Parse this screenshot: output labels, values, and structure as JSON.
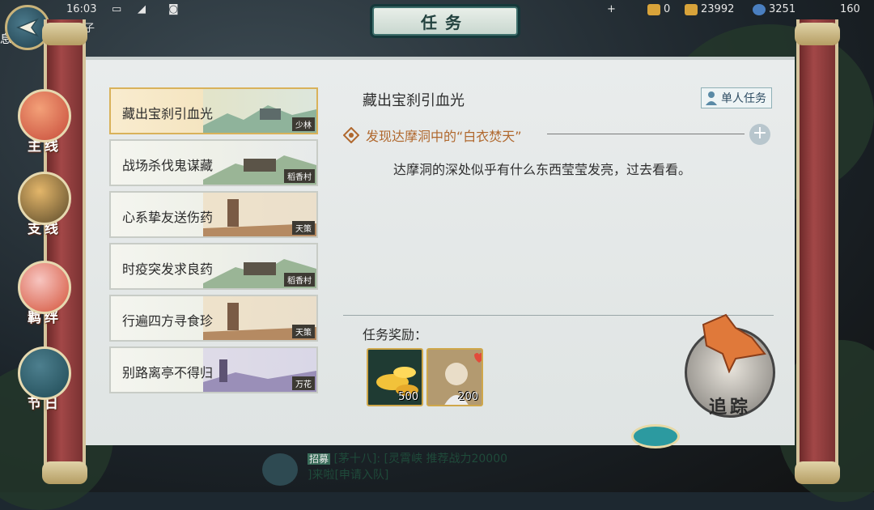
{
  "status_bar": {
    "time": "16:03",
    "currency_1": "0",
    "currency_2": "23992",
    "currency_3": "3251",
    "currency_4": "160"
  },
  "player": {
    "name_partial": "破阵子",
    "edge_char": "息"
  },
  "title": "任务",
  "nav": [
    {
      "label": "主线",
      "icon": "dragon-icon"
    },
    {
      "label": "支线",
      "icon": "tiger-icon"
    },
    {
      "label": "羁绊",
      "icon": "lotus-icon"
    },
    {
      "label": "节日",
      "icon": "fish-icon"
    }
  ],
  "quests": [
    {
      "name": "藏出宝刹引血光",
      "location": "少林",
      "selected": true
    },
    {
      "name": "战场杀伐鬼谋藏",
      "location": "稻香村",
      "selected": false
    },
    {
      "name": "心系挚友送伤药",
      "location": "天策",
      "selected": false
    },
    {
      "name": "时疫突发求良药",
      "location": "稻香村",
      "selected": false
    },
    {
      "name": "行遍四方寻食珍",
      "location": "天策",
      "selected": false
    },
    {
      "name": "别路离亭不得归",
      "location": "万花",
      "selected": false
    }
  ],
  "detail": {
    "title": "藏出宝刹引血光",
    "solo_tag": "单人任务",
    "objective": "发现达摩洞中的“白衣焚天”",
    "description": "达摩洞的深处似乎有什么东西莹莹发亮，过去看看。",
    "reward_label": "任务奖励：",
    "rewards": [
      {
        "name": "gold-ingots",
        "qty": "500"
      },
      {
        "name": "npc-favor",
        "qty": "200"
      }
    ],
    "track_label": "追踪"
  },
  "chat": {
    "tag": "招募",
    "text": "[茅十八]: [灵霄峡 推荐战力20000",
    "text2": "]来啦[申请入队]"
  },
  "colors": {
    "accent": "#b0682e",
    "paper": "#e3e8e7",
    "roller": "#a24747"
  }
}
